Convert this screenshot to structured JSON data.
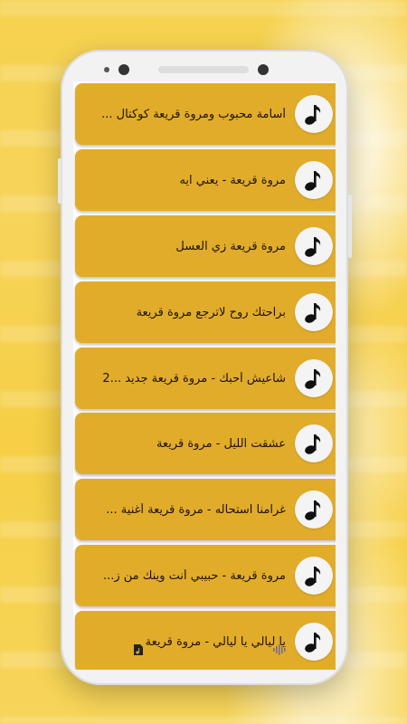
{
  "colors": {
    "accent": "#e2ac2b",
    "background": "#f6d24e",
    "note_circle": "#f4f4f4",
    "text": "#1e1408"
  },
  "songs": [
    {
      "title": "أسامة محبوب ومروة قريعة كوكتال ...",
      "icon": "music-note-icon"
    },
    {
      "title": "مروة قريعة - يعني ايه",
      "icon": "music-note-icon"
    },
    {
      "title": "مروة قريعة زي العسل",
      "icon": "music-note-icon"
    },
    {
      "title": "براحتك روح لاترجع مروة قريعة",
      "icon": "music-note-icon"
    },
    {
      "title": "شاعيش أحبك - مروة قريعة جديد ...2",
      "icon": "music-note-icon"
    },
    {
      "title": "عشقت الليل - مروة قريعة",
      "icon": "music-note-icon"
    },
    {
      "title": "غرامنا استحاله - مروة قريعة أغنية ...",
      "icon": "music-note-icon"
    },
    {
      "title": "مروة قريعة - حبيبي أنت وينك من ز...",
      "icon": "music-note-icon"
    },
    {
      "title": "يا ليالي يا ليالي - مروة قريعة",
      "icon": "music-note-icon"
    }
  ],
  "nav_icons": [
    "music-file-icon",
    "audio-wave-icon"
  ]
}
